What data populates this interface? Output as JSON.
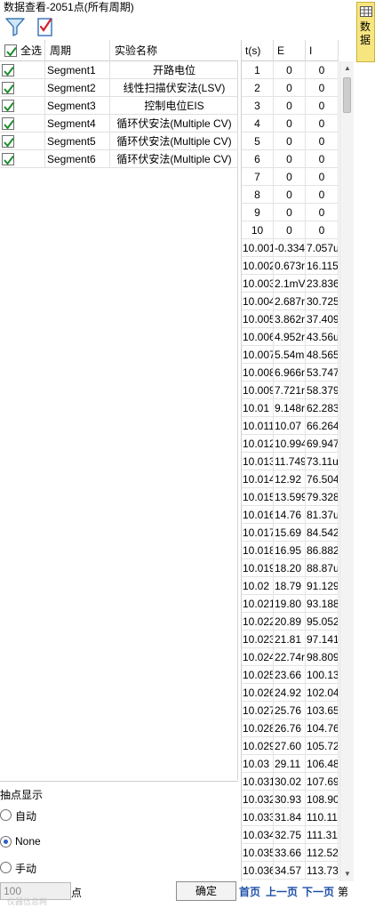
{
  "window": {
    "title": "数据查看-2051点(所有周期)"
  },
  "toolbar": {
    "filter_icon": "funnel-icon",
    "check_icon": "checklist-icon"
  },
  "segments": {
    "select_all_label": "全选",
    "col_period": "周期",
    "col_name": "实验名称",
    "rows": [
      {
        "period": "Segment1",
        "name": "开路电位",
        "checked": true
      },
      {
        "period": "Segment2",
        "name": "线性扫描伏安法(LSV)",
        "checked": true
      },
      {
        "period": "Segment3",
        "name": "控制电位EIS",
        "checked": true
      },
      {
        "period": "Segment4",
        "name": "循环伏安法(Multiple CV)",
        "checked": true
      },
      {
        "period": "Segment5",
        "name": "循环伏安法(Multiple CV)",
        "checked": true
      },
      {
        "period": "Segment6",
        "name": "循环伏安法(Multiple CV)",
        "checked": true
      }
    ]
  },
  "sampling": {
    "label": "抽点显示",
    "opt_auto": "自动",
    "opt_none": "None",
    "opt_manual": "手动",
    "selected": "None",
    "points_value": "100",
    "points_unit": "点",
    "ok_label": "确定",
    "watermark": "仪器信息网"
  },
  "data_table": {
    "headers": [
      "t(s)",
      "E",
      "I"
    ],
    "rows": [
      [
        "1",
        "0",
        "0"
      ],
      [
        "2",
        "0",
        "0"
      ],
      [
        "3",
        "0",
        "0"
      ],
      [
        "4",
        "0",
        "0"
      ],
      [
        "5",
        "0",
        "0"
      ],
      [
        "6",
        "0",
        "0"
      ],
      [
        "7",
        "0",
        "0"
      ],
      [
        "8",
        "0",
        "0"
      ],
      [
        "9",
        "0",
        "0"
      ],
      [
        "10",
        "0",
        "0"
      ],
      [
        "10.001",
        "-0.334",
        "7.057u"
      ],
      [
        "10.002",
        "0.673r",
        "16.115"
      ],
      [
        "10.003",
        "2.1mV",
        "23.836"
      ],
      [
        "10.004",
        "2.687r",
        "30.725"
      ],
      [
        "10.005",
        "3.862r",
        "37.409"
      ],
      [
        "10.006",
        "4.952r",
        "43.56u"
      ],
      [
        "10.007",
        "5.54m",
        "48.565"
      ],
      [
        "10.008",
        "6.966r",
        "53.747"
      ],
      [
        "10.009",
        "7.721r",
        "58.379"
      ],
      [
        "10.01",
        "9.148r",
        "62.283"
      ],
      [
        "10.011",
        "10.07",
        "66.264"
      ],
      [
        "10.012",
        "10.994",
        "69.947"
      ],
      [
        "10.013",
        "11.749",
        "73.11u"
      ],
      [
        "10.014",
        "12.92",
        "76.504"
      ],
      [
        "10.015",
        "13.599",
        "79.328"
      ],
      [
        "10.016",
        "14.76",
        "81.37u"
      ],
      [
        "10.017",
        "15.69",
        "84.542"
      ],
      [
        "10.018",
        "16.95",
        "86.882"
      ],
      [
        "10.019",
        "18.20",
        "88.87u"
      ],
      [
        "10.02",
        "18.79",
        "91.129"
      ],
      [
        "10.021",
        "19.80",
        "93.188"
      ],
      [
        "10.022",
        "20.89",
        "95.052"
      ],
      [
        "10.023",
        "21.81",
        "97.141"
      ],
      [
        "10.024",
        "22.74r",
        "98.809"
      ],
      [
        "10.025",
        "23.66",
        "100.13"
      ],
      [
        "10.026",
        "24.92",
        "102.04"
      ],
      [
        "10.027",
        "25.76",
        "103.65"
      ],
      [
        "10.028",
        "26.76",
        "104.76"
      ],
      [
        "10.029",
        "27.60",
        "105.72"
      ],
      [
        "10.03",
        "29.11",
        "106.48"
      ],
      [
        "10.031",
        "30.02",
        "107.69"
      ],
      [
        "10.032",
        "30.93",
        "108.90"
      ],
      [
        "10.033",
        "31.84",
        "110.11"
      ],
      [
        "10.034",
        "32.75",
        "111.31"
      ],
      [
        "10.035",
        "33.66",
        "112.52"
      ],
      [
        "10.036",
        "34.57",
        "113.73"
      ]
    ]
  },
  "pager": {
    "first": "首页",
    "prev": "上一页",
    "next": "下一页",
    "nth": "第"
  },
  "side_tab": {
    "label": "数据",
    "icon": "table-grid-icon"
  }
}
